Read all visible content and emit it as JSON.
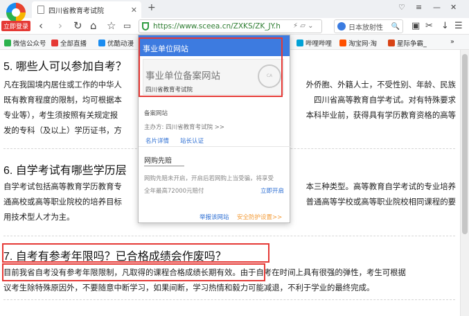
{
  "browser": {
    "login_badge": "立即登录",
    "tab_title": "四川省教育考试院",
    "tab_close": "✕",
    "new_tab": "+",
    "url": "https://www.sceea.cn/ZXKS/ZK_JY.h",
    "search_text": "日本放射性",
    "bookmarks": [
      "微信公众号",
      "全部直播",
      "优酷动漫",
      "哔哩哔哩",
      "淘宝网·淘",
      "星际争霸_"
    ],
    "more": "»"
  },
  "content": {
    "q5_title": "5. 哪些人可以参加自考？",
    "q5_lines": [
      "凡在我国境内居住或工作的中华人",
      "既有教育程度的限制，均可根据本",
      "专业等），考生须按照有关规定报",
      "发的专科（及以上）学历证书，方"
    ],
    "q5_right": [
      "外侨胞、外籍人士，不受性别、年龄、民族",
      "四川省高等教育自学考试。对有特殊要求",
      "本科毕业前，获得具有学历教育资格的高等",
      ""
    ],
    "q6_title": "6. 自学考试有哪些学历层",
    "q6_lines": [
      "自学考试包括高等教育学历教育专",
      "通高校或高等职业院校的培养目标",
      "用技术型人才为主。"
    ],
    "q6_right": [
      "本三种类型。高等教育自学考试的专业培养",
      "普通高等学校或高等职业院校相同课程的要",
      ""
    ],
    "q7_title": "7. 自考有参考年限吗？已合格成绩会作废吗？",
    "q7_lines": [
      "目前我省自考没有参考年限限制，凡取得的课程合格成绩长期有效。由于自考在时间上具有很强的弹性，考生可根据",
      "议考生除特殊原因外，不要随意中断学习，如果间断，学习热情和毅力可能减退，不利于学业的最终完成。"
    ]
  },
  "popup": {
    "header": "事业单位网站",
    "card_title": "事业单位备案网站",
    "card_org": "四川省教育考试院",
    "stamp": "CA",
    "record_label": "备案网站",
    "sponsor": "主办方: 四川省教育考试院 >>",
    "link1": "名片详情",
    "link2": "站长认证",
    "shop_title": "网购先赔",
    "shop_line1": "网购先赔未开启，开启后若网购上当受骗，将享受",
    "shop_line2": "全年最高72000元赔付",
    "shop_action": "立即开启",
    "report": "举报该网站",
    "settings": "安全防护设置>>"
  }
}
